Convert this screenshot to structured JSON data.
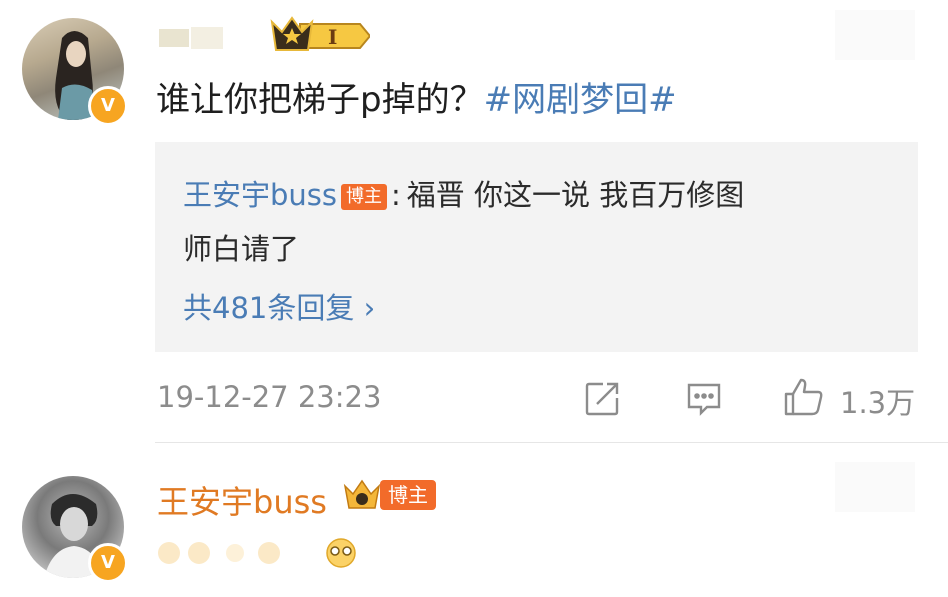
{
  "comment": {
    "rank_badge": "I",
    "text": "谁让你把梯子p掉的？",
    "hashtag": "#网剧梦回#",
    "reply": {
      "author": "王安宇buss",
      "author_tag": "博主",
      "separator": ":",
      "text_line1": "福晋 你这一说 我百万修图",
      "text_line2": "师白请了",
      "more_replies": "共481条回复 ›"
    },
    "timestamp": "19-12-27 23:23",
    "likes": "1.3万"
  },
  "comment2": {
    "author": "王安宇buss",
    "author_tag": "博主"
  },
  "colors": {
    "link_blue": "#4a7cb5",
    "blogger_orange": "#f26b2a",
    "vip_name_orange": "#e07a23",
    "verified_gold": "#f7a521"
  },
  "icons": [
    "verified-v-icon",
    "crown-icon",
    "share-icon",
    "comment-icon",
    "like-icon",
    "emoji-icon"
  ]
}
